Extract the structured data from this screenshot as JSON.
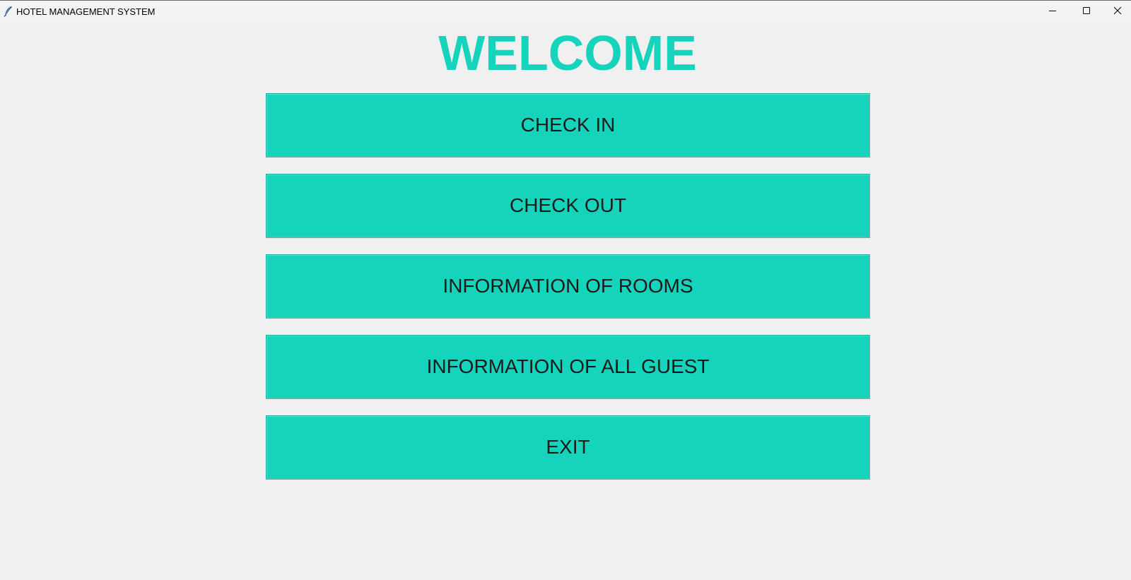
{
  "window": {
    "title": "HOTEL MANAGEMENT SYSTEM",
    "app_icon": "feather-icon",
    "controls": [
      "minimize-icon",
      "maximize-icon",
      "close-icon"
    ]
  },
  "main": {
    "heading": "WELCOME",
    "buttons": [
      {
        "label": "CHECK IN"
      },
      {
        "label": "CHECK OUT"
      },
      {
        "label": "INFORMATION OF ROOMS"
      },
      {
        "label": "INFORMATION OF ALL GUEST"
      },
      {
        "label": "EXIT"
      }
    ]
  },
  "colors": {
    "accent": "#16d4bc",
    "background": "#f0f0f0",
    "button_text": "#1a1a1a"
  }
}
